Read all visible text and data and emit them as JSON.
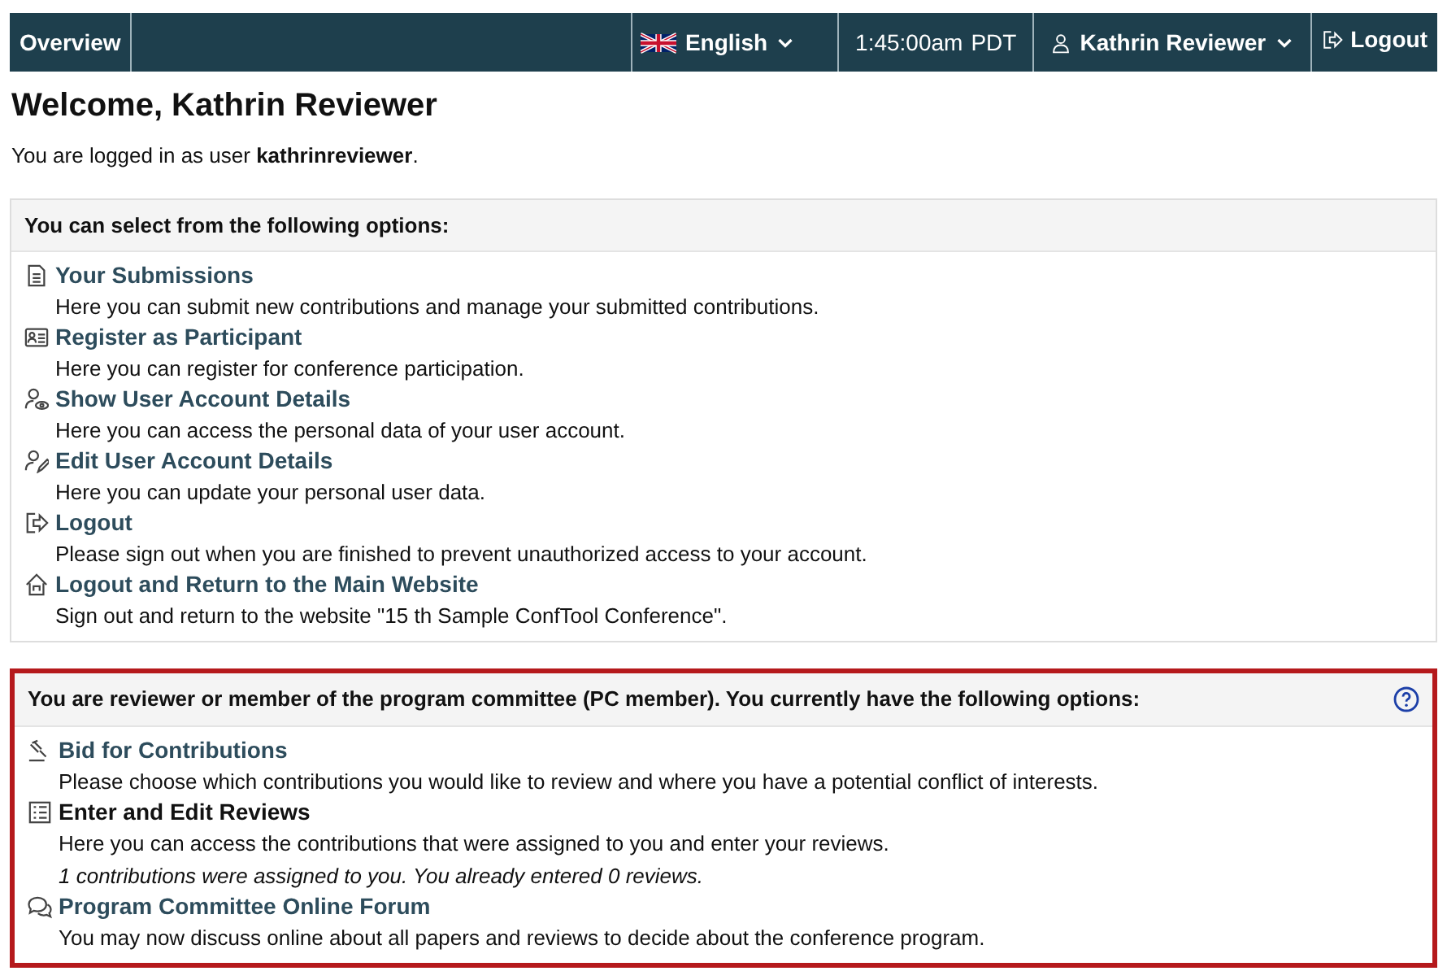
{
  "navbar": {
    "home": "Overview",
    "language": "English",
    "time": "1:45:00am",
    "timezone": "PDT",
    "user": "Kathrin Reviewer",
    "logout": "Logout"
  },
  "welcome": {
    "title": "Welcome, Kathrin Reviewer",
    "text": "You are logged in as user **kathrinreviewer**."
  },
  "panels": [
    {
      "title": "You can select from the following options:",
      "highlighted": false,
      "help": false,
      "items": [
        {
          "label": "Your Submissions",
          "emphasized": false,
          "description": "Here you can submit new contributions and manage your submitted contributions."
        },
        {
          "label": "Register as Participant",
          "emphasized": false,
          "description": "Here you can register for conference participation."
        },
        {
          "label": "Show User Account Details",
          "emphasized": false,
          "description": "Here you can access the personal data of your user account."
        },
        {
          "label": "Edit User Account Details",
          "emphasized": false,
          "description": "Here you can update your personal user data."
        },
        {
          "label": "Logout",
          "emphasized": false,
          "description": "Please sign out when you are finished to prevent unauthorized access to your account."
        },
        {
          "label": "Logout and Return to the Main Website",
          "emphasized": false,
          "description": "Sign out and return to the website \"15 th Sample ConfTool Conference\"."
        }
      ]
    },
    {
      "title": "You are reviewer or member of the program committee (PC member). You currently have the following options:",
      "highlighted": true,
      "help": true,
      "items": [
        {
          "label": "Bid for Contributions",
          "emphasized": false,
          "description": "Please choose which contributions you would like to review and where you have a potential conflict of interests."
        },
        {
          "label": "Enter and Edit Reviews",
          "emphasized": true,
          "description": "Here you can access the contributions that were assigned to you and enter your reviews.",
          "note": "1 contributions were assigned to you. You already entered 0 reviews."
        },
        {
          "label": "Program Committee Online Forum",
          "emphasized": false,
          "description": "You may now discuss online about all papers and reviews to decide about the conference program."
        }
      ]
    }
  ]
}
